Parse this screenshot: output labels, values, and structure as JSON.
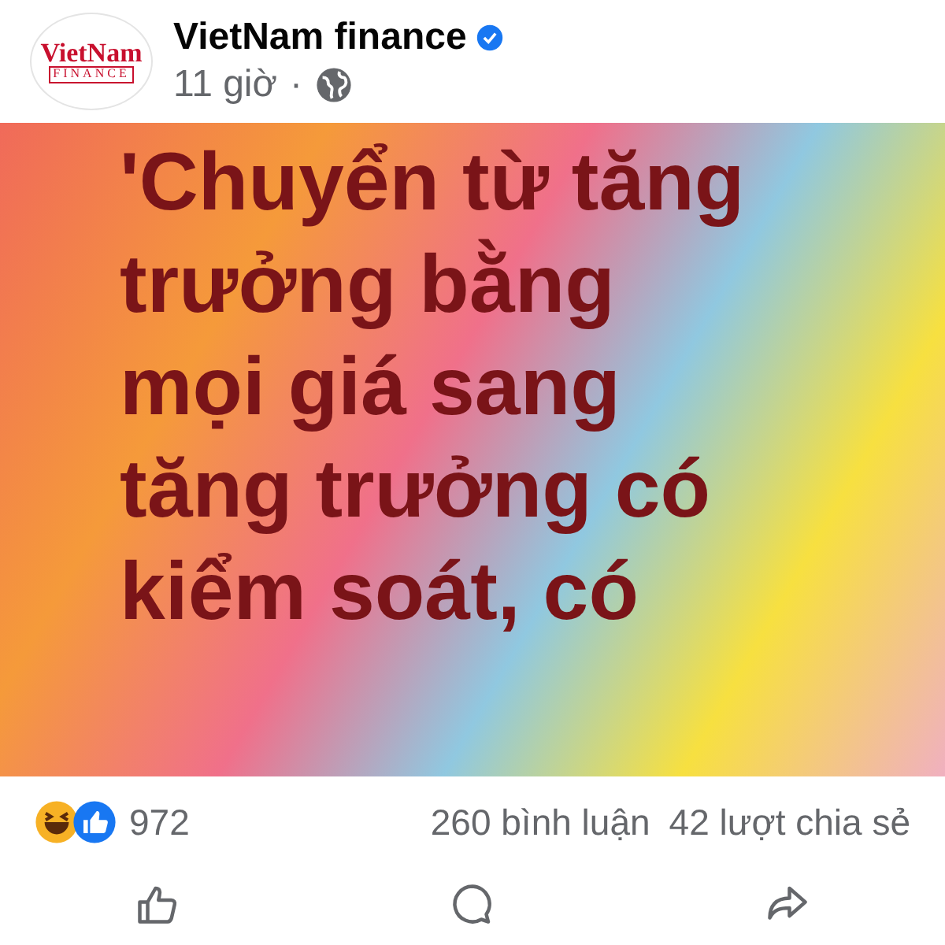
{
  "post": {
    "page_name": "VietNam finance",
    "logo": {
      "top": "VietNam",
      "bottom": "FINANCE"
    },
    "time": "11 giờ",
    "separator": "·",
    "text_lines": [
      "'Chuyển từ tăng",
      "trưởng bằng",
      "mọi giá sang",
      "tăng trưởng có",
      "kiểm soát, có"
    ],
    "reactions": {
      "count": "972",
      "comments": "260 bình luận",
      "shares": "42 lượt chia sẻ"
    },
    "actions": [
      {
        "kind": "like"
      },
      {
        "kind": "comment"
      },
      {
        "kind": "share"
      }
    ]
  }
}
